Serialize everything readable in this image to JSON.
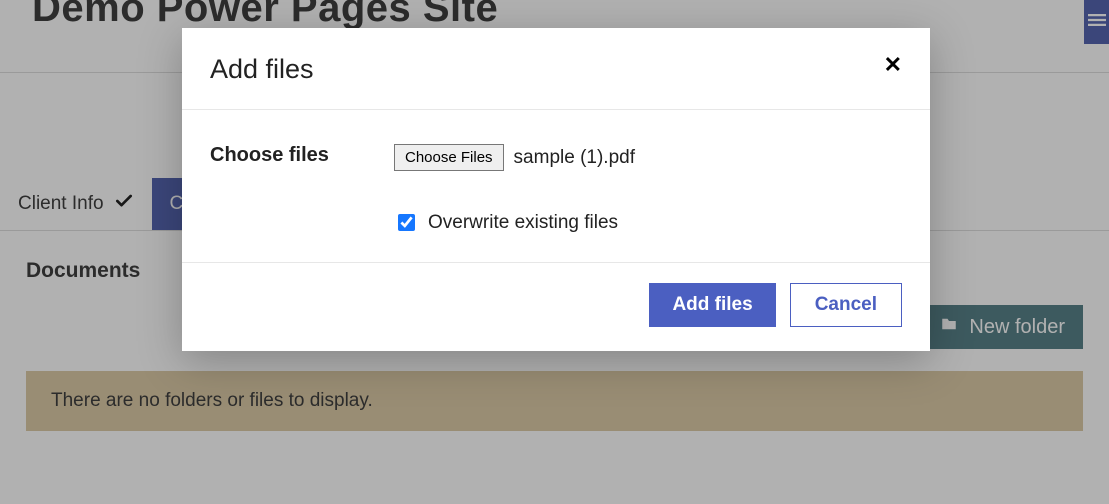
{
  "header": {
    "site_title": "Demo Power Pages Site"
  },
  "tabs": {
    "items": [
      {
        "label": "Client Info",
        "completed": true,
        "active": false
      },
      {
        "label": "Cl",
        "completed": false,
        "active": true
      }
    ]
  },
  "section": {
    "title": "Documents",
    "new_folder_label": "New folder",
    "empty_message": "There are no folders or files to display."
  },
  "modal": {
    "title": "Add files",
    "choose_files_label": "Choose files",
    "choose_files_button": "Choose Files",
    "selected_file_name": "sample (1).pdf",
    "overwrite_label": "Overwrite existing files",
    "overwrite_checked": true,
    "submit_label": "Add files",
    "cancel_label": "Cancel"
  }
}
